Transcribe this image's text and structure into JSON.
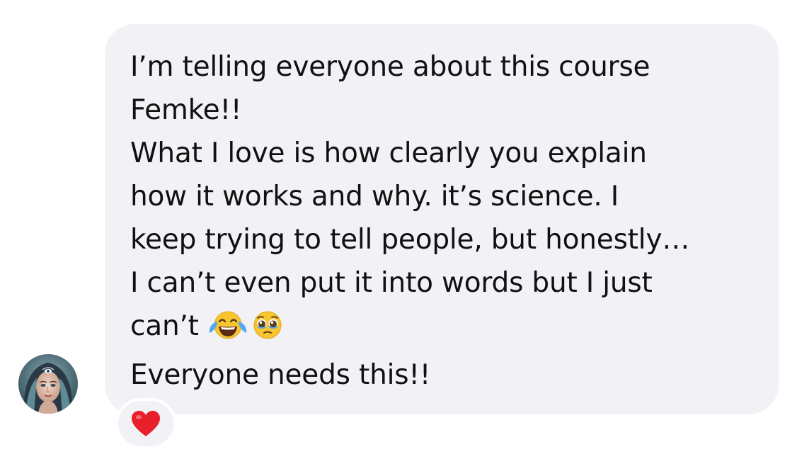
{
  "message": {
    "lines": [
      "I’m telling everyone about this course",
      "Femke!!",
      "What I love is how clearly you explain",
      "how it works and why. it’s science. I",
      "keep trying to tell people, but honestly…",
      "I can’t even put it into words but I just",
      "can’t",
      "Everyone needs this!!"
    ],
    "emojis": [
      "face-with-tears-of-joy-icon",
      "pleading-face-icon"
    ]
  },
  "reaction": {
    "icon": "red-heart-icon",
    "color": "#e8202b"
  },
  "colors": {
    "bubble": "#f2f2f6",
    "text": "#111111",
    "background": "#ffffff"
  }
}
